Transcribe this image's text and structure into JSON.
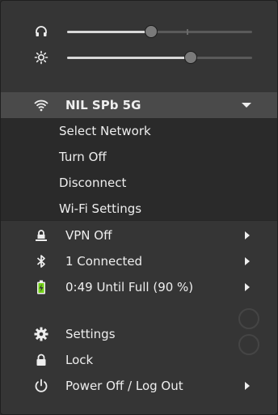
{
  "sliders": {
    "volume": {
      "icon": "headphones-icon",
      "level": 0.45
    },
    "brightness": {
      "icon": "brightness-icon",
      "level": 0.68
    }
  },
  "wifi": {
    "network_name": "NIL SPb 5G",
    "items": [
      "Select Network",
      "Turn Off",
      "Disconnect",
      "Wi-Fi Settings"
    ]
  },
  "vpn": {
    "label": "VPN Off"
  },
  "bluetooth": {
    "label": "1 Connected"
  },
  "battery": {
    "label": "0:49 Until Full (90 %)"
  },
  "actions": {
    "settings": "Settings",
    "lock": "Lock",
    "power": "Power Off / Log Out"
  },
  "colors": {
    "menu_bg": "#353535",
    "wifi_header_bg": "#4a4a4a",
    "wifi_submenu_bg": "#2a2a2a",
    "text": "#eeeeee",
    "battery_charging": "#73d216"
  }
}
